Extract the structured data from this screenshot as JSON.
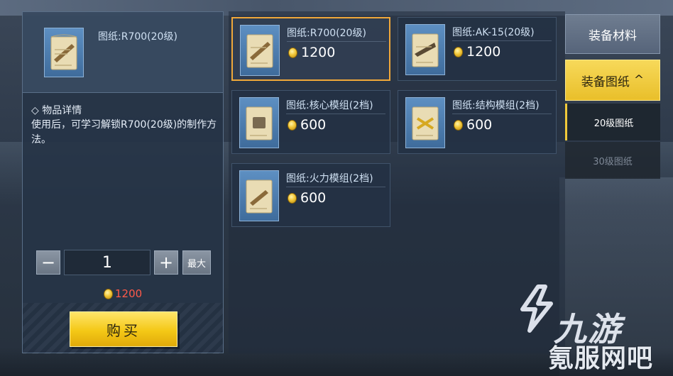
{
  "detail": {
    "item_name": "图纸:R700(20级)",
    "details_label": "◇ 物品详情",
    "description": "使用后，可学习解锁R700(20级)的制作方法。"
  },
  "purchase": {
    "minus_label": "−",
    "quantity": "1",
    "plus_label": "+",
    "max_label": "最大",
    "total_cost": "1200",
    "buy_label": "购买"
  },
  "shop_items": [
    {
      "name": "图纸:R700(20级)",
      "price": "1200",
      "selected": true
    },
    {
      "name": "图纸:AK-15(20级)",
      "price": "1200",
      "selected": false
    },
    {
      "name": "图纸:核心模组(2档)",
      "price": "600",
      "selected": false
    },
    {
      "name": "图纸:结构模组(2档)",
      "price": "600",
      "selected": false
    },
    {
      "name": "图纸:火力模组(2档)",
      "price": "600",
      "selected": false
    }
  ],
  "tabs": {
    "materials": "装备材料",
    "blueprints": "装备图纸",
    "blueprints_chevron": "^",
    "sub_tabs": [
      "20级图纸",
      "30级图纸"
    ],
    "active_sub_tab": "20级图纸"
  },
  "watermark": {
    "brand": "九游",
    "site": "氪服网吧"
  },
  "colors": {
    "selected_border": "#f0a83a",
    "buy_button": "#f4c816",
    "cost_red": "#ff5a4a",
    "active_tab": "#e9bf2a",
    "coin": "#f2c83a"
  },
  "icons": {
    "thumbnail": "blueprint-scroll-icon",
    "currency": "gold-coin-icon",
    "chevron": "chevron-up-icon"
  }
}
